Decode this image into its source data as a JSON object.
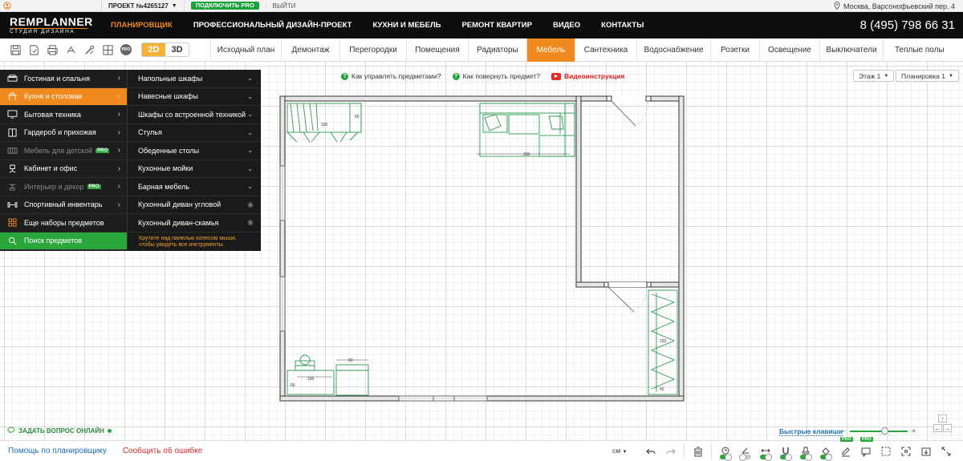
{
  "topbar": {
    "project_label": "ПРОЕКТ №4265127",
    "pro_button": "ПОДКЛЮЧИТЬ PRO",
    "exit_label": "ВЫЙТИ",
    "address": "Москва, Варсонофьевский пер. 4"
  },
  "navbar": {
    "logo_main_a": "REM",
    "logo_main_b": "PLANNER",
    "logo_sub": "СТУДИЯ ДИЗАЙНА",
    "items": [
      {
        "label": "ПЛАНИРОВЩИК"
      },
      {
        "label": "ПРОФЕССИОНАЛЬНЫЙ ДИЗАЙН-ПРОЕКТ"
      },
      {
        "label": "КУХНИ И МЕБЕЛЬ"
      },
      {
        "label": "РЕМОНТ КВАРТИР"
      },
      {
        "label": "ВИДЕО"
      },
      {
        "label": "КОНТАКТЫ"
      }
    ],
    "phone": "8 (495) 798 66 31"
  },
  "toolbar": {
    "pro_icon": "PRO",
    "mode_2d": "2D",
    "mode_3d": "3D",
    "tabs": [
      {
        "label": "Исходный план"
      },
      {
        "label": "Демонтаж"
      },
      {
        "label": "Перегородки"
      },
      {
        "label": "Помещения"
      },
      {
        "label": "Радиаторы"
      },
      {
        "label": "Мебель"
      },
      {
        "label": "Сантехника"
      },
      {
        "label": "Водоснабжение"
      },
      {
        "label": "Розетки"
      },
      {
        "label": "Освещение"
      },
      {
        "label": "Выключатели"
      },
      {
        "label": "Теплые полы"
      }
    ]
  },
  "help_links": {
    "manage_items": "Как управлять предметами?",
    "rotate_item": "Как повернуть предмет?",
    "video": "Видеоинструкция"
  },
  "floor": {
    "floor_label": "Этаж 1",
    "layout_label": "Планировка 1"
  },
  "categories": [
    {
      "label": "Гостиная и спальня"
    },
    {
      "label": "Кухня и столовая"
    },
    {
      "label": "Бытовая техника"
    },
    {
      "label": "Гардероб и прихожая"
    },
    {
      "label": "Мебель для детской",
      "badge": "PRO"
    },
    {
      "label": "Кабинет и офис"
    },
    {
      "label": "Интерьер и декор",
      "badge": "PRO"
    },
    {
      "label": "Спортивный инвентарь"
    },
    {
      "label": "Еще наборы предметов"
    },
    {
      "label": "Поиск предметов"
    }
  ],
  "subcategories": [
    {
      "label": "Напольные шкафы"
    },
    {
      "label": "Навесные шкафы"
    },
    {
      "label": "Шкафы со встроенной техникой"
    },
    {
      "label": "Стулья"
    },
    {
      "label": "Обеденные столы"
    },
    {
      "label": "Кухонные мойки"
    },
    {
      "label": "Барная мебель"
    },
    {
      "label": "Кухонный диван угловой"
    },
    {
      "label": "Кухонный диван-скамья"
    }
  ],
  "sub_hint": "Крутите над панелью колесом мыши, чтобы увидеть все инструменты.",
  "plan": {
    "dims": {
      "cab_top": "150",
      "cab_top_side": "60",
      "sofa": "200",
      "table": "100",
      "table_side": "60",
      "stove": "60",
      "wardrobe": "220",
      "wardrobe_bottom": "60"
    }
  },
  "bottom": {
    "ask_question": "ЗАДАТЬ ВОПРОС ОНЛАЙН",
    "hotkeys": "Быстрые клавиши",
    "zoom_minus": "−",
    "zoom_plus": "+",
    "zoom_level": 0.6,
    "help_link": "Помощь по планировщику",
    "report_error": "Сообщить об ошибке",
    "units": "см",
    "pro_badge": "PRO"
  },
  "colors": {
    "accent": "#f08a1e",
    "green": "#2aa63a",
    "furniture": "#2d9a4f"
  }
}
